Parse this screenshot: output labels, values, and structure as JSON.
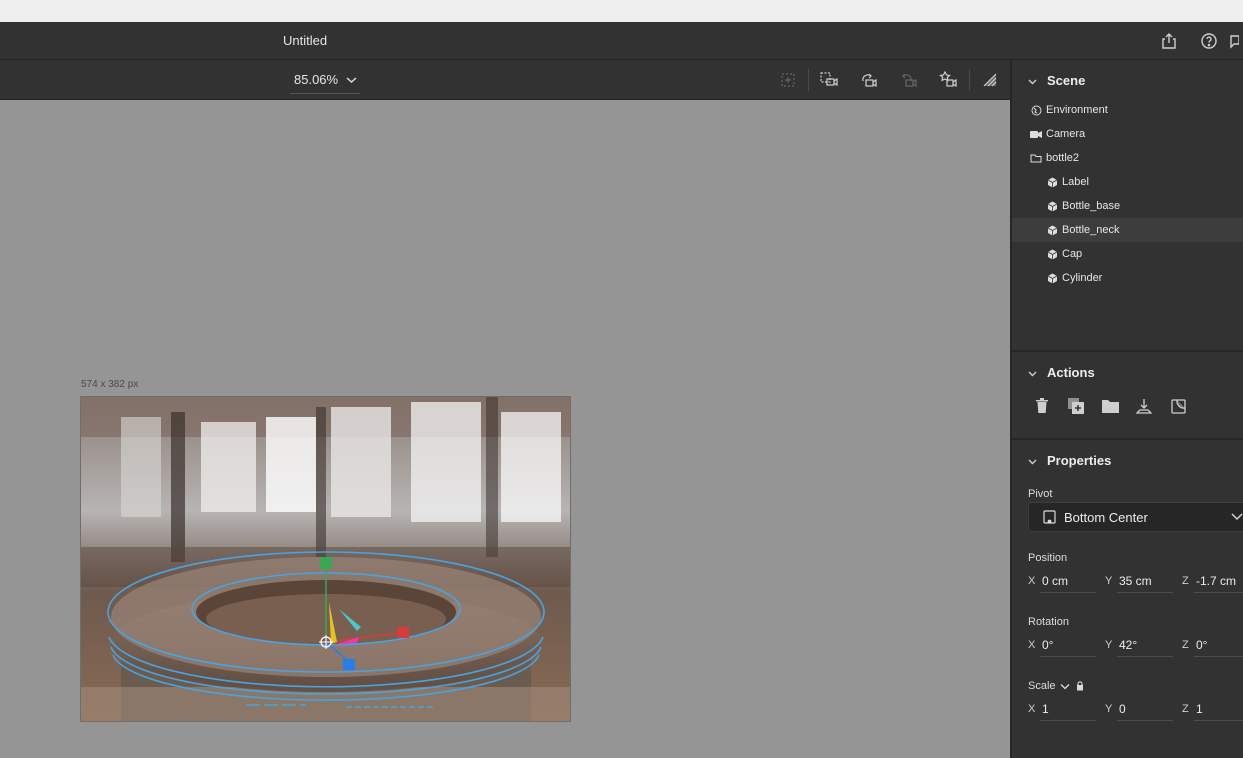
{
  "app": {
    "document_title": "Untitled"
  },
  "toolbar": {
    "zoom_value": "85.06%"
  },
  "canvas": {
    "artboard_size": "574 x 382 px"
  },
  "scene": {
    "title": "Scene",
    "items": [
      {
        "label": "Environment",
        "icon": "globe-icon",
        "level": 0
      },
      {
        "label": "Camera",
        "icon": "camera-icon",
        "level": 0
      },
      {
        "label": "bottle2",
        "icon": "folder-icon",
        "level": 0
      },
      {
        "label": "Label",
        "icon": "cube-icon",
        "level": 1
      },
      {
        "label": "Bottle_base",
        "icon": "cube-icon",
        "level": 1
      },
      {
        "label": "Bottle_neck",
        "icon": "cube-icon",
        "level": 1,
        "selected": true
      },
      {
        "label": "Cap",
        "icon": "cube-icon",
        "level": 1
      },
      {
        "label": "Cylinder",
        "icon": "cube-icon",
        "level": 1
      }
    ]
  },
  "actions": {
    "title": "Actions"
  },
  "properties": {
    "title": "Properties",
    "pivot_label": "Pivot",
    "pivot_value": "Bottom Center",
    "position_label": "Position",
    "position": {
      "x": "0 cm",
      "y": "35 cm",
      "z": "-1.7 cm"
    },
    "rotation_label": "Rotation",
    "rotation": {
      "x": "0°",
      "y": "42°",
      "z": "0°"
    },
    "scale_label": "Scale",
    "scale": {
      "x": "1",
      "y": "0",
      "z": "1"
    },
    "axis_x": "X",
    "axis_y": "Y",
    "axis_z": "Z"
  },
  "colors": {
    "panel_bg": "#323232",
    "canvas_bg": "#959595",
    "gizmo_blue": "#4aa3e0",
    "axis_green": "#3aa656",
    "axis_red": "#d63c3c",
    "axis_blue": "#2a7de8"
  }
}
